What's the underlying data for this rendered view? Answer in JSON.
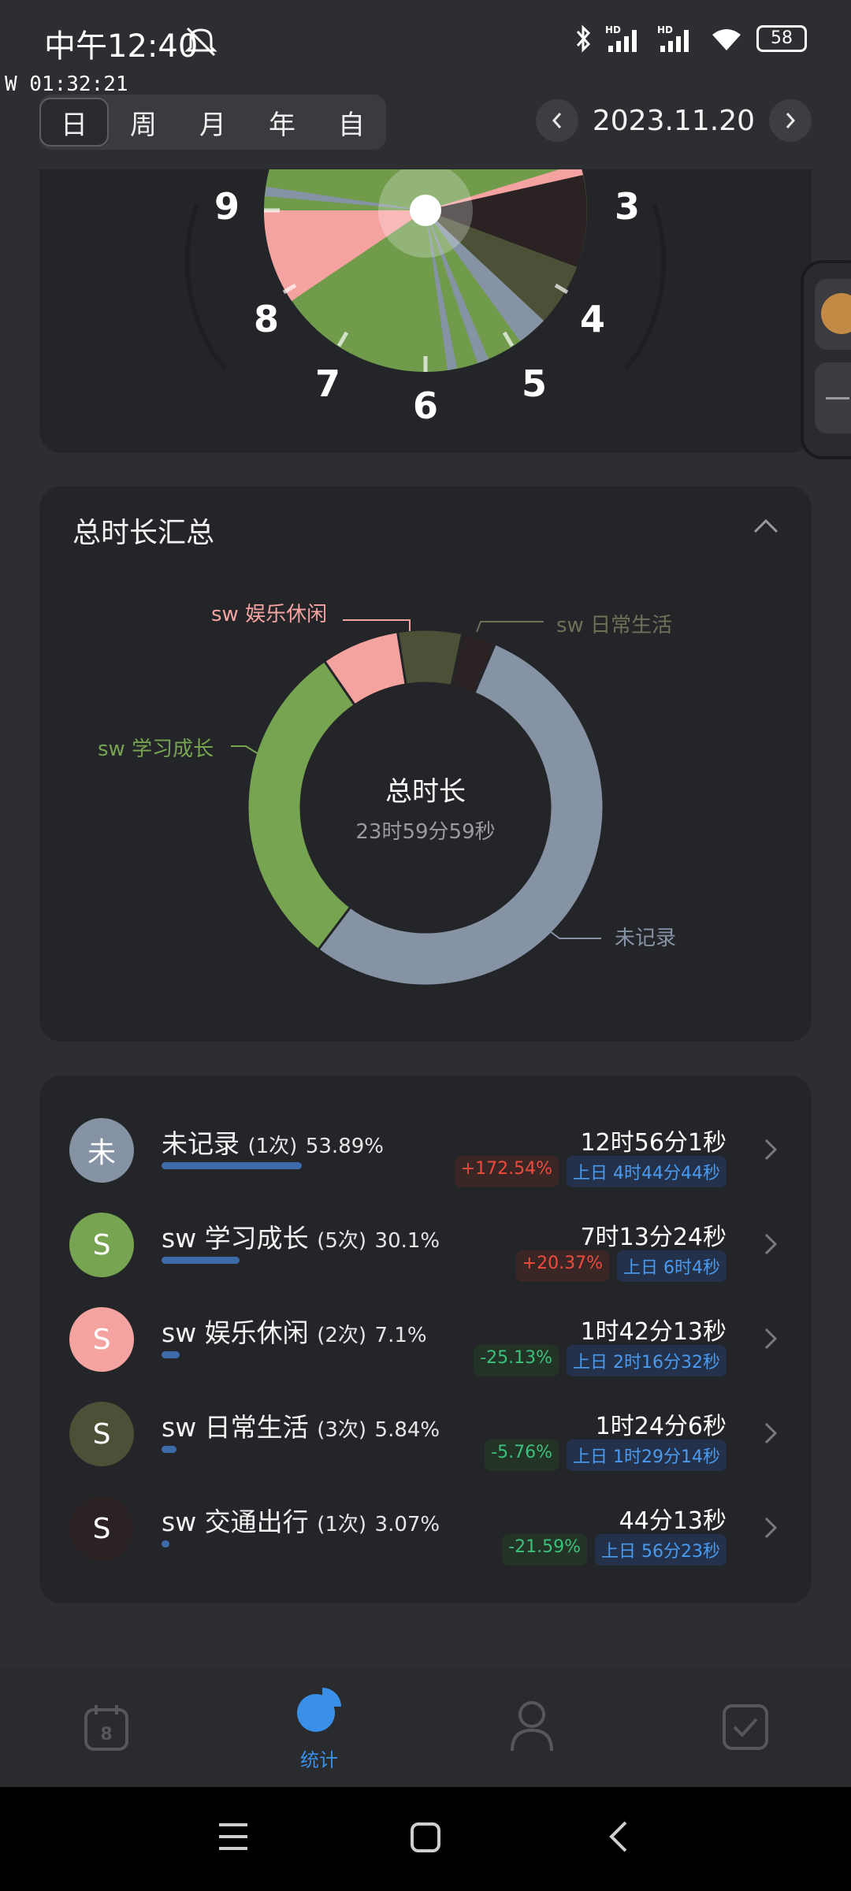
{
  "status_bar": {
    "time": "中午12:40",
    "battery": "58",
    "icons": [
      "mute-icon",
      "bluetooth-icon",
      "signal-hd-icon",
      "signal-hd-icon",
      "wifi-icon",
      "battery-icon"
    ]
  },
  "debug_timer": "W 01:32:21",
  "period_tabs": [
    {
      "label": "日",
      "active": true
    },
    {
      "label": "周",
      "active": false
    },
    {
      "label": "月",
      "active": false
    },
    {
      "label": "年",
      "active": false
    },
    {
      "label": "自",
      "active": false
    }
  ],
  "date_nav": {
    "date": "2023.11.20"
  },
  "clock": {
    "labels": [
      "9",
      "3",
      "8",
      "4",
      "7",
      "5",
      "6"
    ]
  },
  "summary": {
    "title": "总时长汇总",
    "center_label": "总时长",
    "center_value": "23时59分59秒",
    "labels": {
      "entertainment": "sw 娱乐休闲",
      "daily": "sw 日常生活",
      "study": "sw 学习成长",
      "unrecorded": "未记录"
    }
  },
  "chart_data": {
    "type": "pie",
    "title": "总时长汇总",
    "center_label": "总时长",
    "center_value": "23时59分59秒",
    "slices": [
      {
        "name": "未记录",
        "value": 53.89,
        "color": "#8593a4"
      },
      {
        "name": "sw 学习成长",
        "value": 30.1,
        "color": "#76a451"
      },
      {
        "name": "sw 娱乐休闲",
        "value": 7.1,
        "color": "#f5a3a0"
      },
      {
        "name": "sw 日常生活",
        "value": 5.84,
        "color": "#4b5036"
      },
      {
        "name": "sw 交通出行",
        "value": 3.07,
        "color": "#2b2223"
      }
    ]
  },
  "categories": [
    {
      "avatar": "未",
      "name": "未记录",
      "count": "(1次)",
      "percent": "53.89%",
      "duration": "12时56分1秒",
      "change": "+172.54%",
      "trend": "up",
      "prev": "上日 4时44分44秒",
      "color": "#8593a4",
      "share": 0.5389
    },
    {
      "avatar": "S",
      "name": "sw 学习成长",
      "count": "(5次)",
      "percent": "30.1%",
      "duration": "7时13分24秒",
      "change": "+20.37%",
      "trend": "up",
      "prev": "上日 6时4秒",
      "color": "#76a451",
      "share": 0.301
    },
    {
      "avatar": "S",
      "name": "sw 娱乐休闲",
      "count": "(2次)",
      "percent": "7.1%",
      "duration": "1时42分13秒",
      "change": "-25.13%",
      "trend": "down",
      "prev": "上日 2时16分32秒",
      "color": "#f5a3a0",
      "share": 0.071
    },
    {
      "avatar": "S",
      "name": "sw 日常生活",
      "count": "(3次)",
      "percent": "5.84%",
      "duration": "1时24分6秒",
      "change": "-5.76%",
      "trend": "down",
      "prev": "上日 1时29分14秒",
      "color": "#4b5036",
      "share": 0.0584
    },
    {
      "avatar": "S",
      "name": "sw 交通出行",
      "count": "(1次)",
      "percent": "3.07%",
      "duration": "44分13秒",
      "change": "-21.59%",
      "trend": "down",
      "prev": "上日 56分23秒",
      "color": "#2b2223",
      "share": 0.0307
    }
  ],
  "bottom_nav": {
    "items": [
      {
        "icon": "calendar-icon",
        "label": ""
      },
      {
        "icon": "pie-chart-icon",
        "label": "统计",
        "active": true
      },
      {
        "icon": "person-icon",
        "label": ""
      },
      {
        "icon": "checkbox-icon",
        "label": ""
      }
    ]
  },
  "system_nav": [
    "menu-icon",
    "home-icon",
    "back-icon"
  ]
}
